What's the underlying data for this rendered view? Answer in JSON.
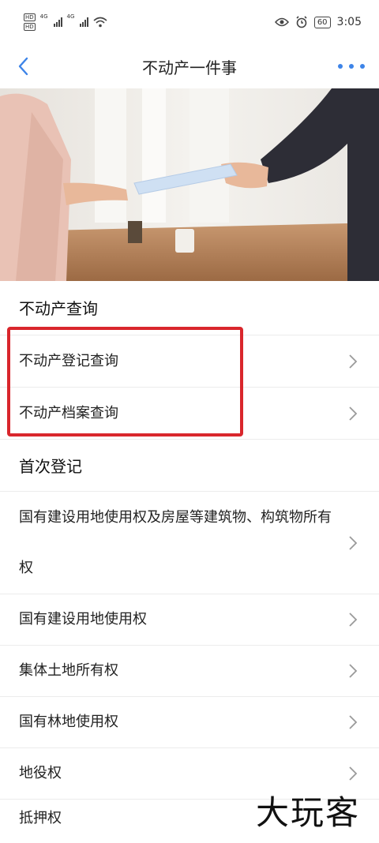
{
  "status_bar": {
    "hd_1": "HD",
    "hd_2": "HD",
    "network_1": "4G",
    "network_2": "4G",
    "battery": "60",
    "time": "3:05"
  },
  "nav": {
    "title": "不动产一件事"
  },
  "sections": {
    "query": {
      "title": "不动产查询",
      "items": [
        "不动产登记查询",
        "不动产档案查询"
      ]
    },
    "first_registration": {
      "title": "首次登记",
      "items": [
        "国有建设用地使用权及房屋等建筑物、构筑物所有权",
        "国有建设用地使用权",
        "集体土地所有权",
        "国有林地使用权",
        "地役权",
        "抵押权"
      ]
    }
  },
  "watermark": "大玩客",
  "colors": {
    "accent": "#3d84e8",
    "highlight": "#d9262c",
    "chevron": "#9a9a9a"
  }
}
